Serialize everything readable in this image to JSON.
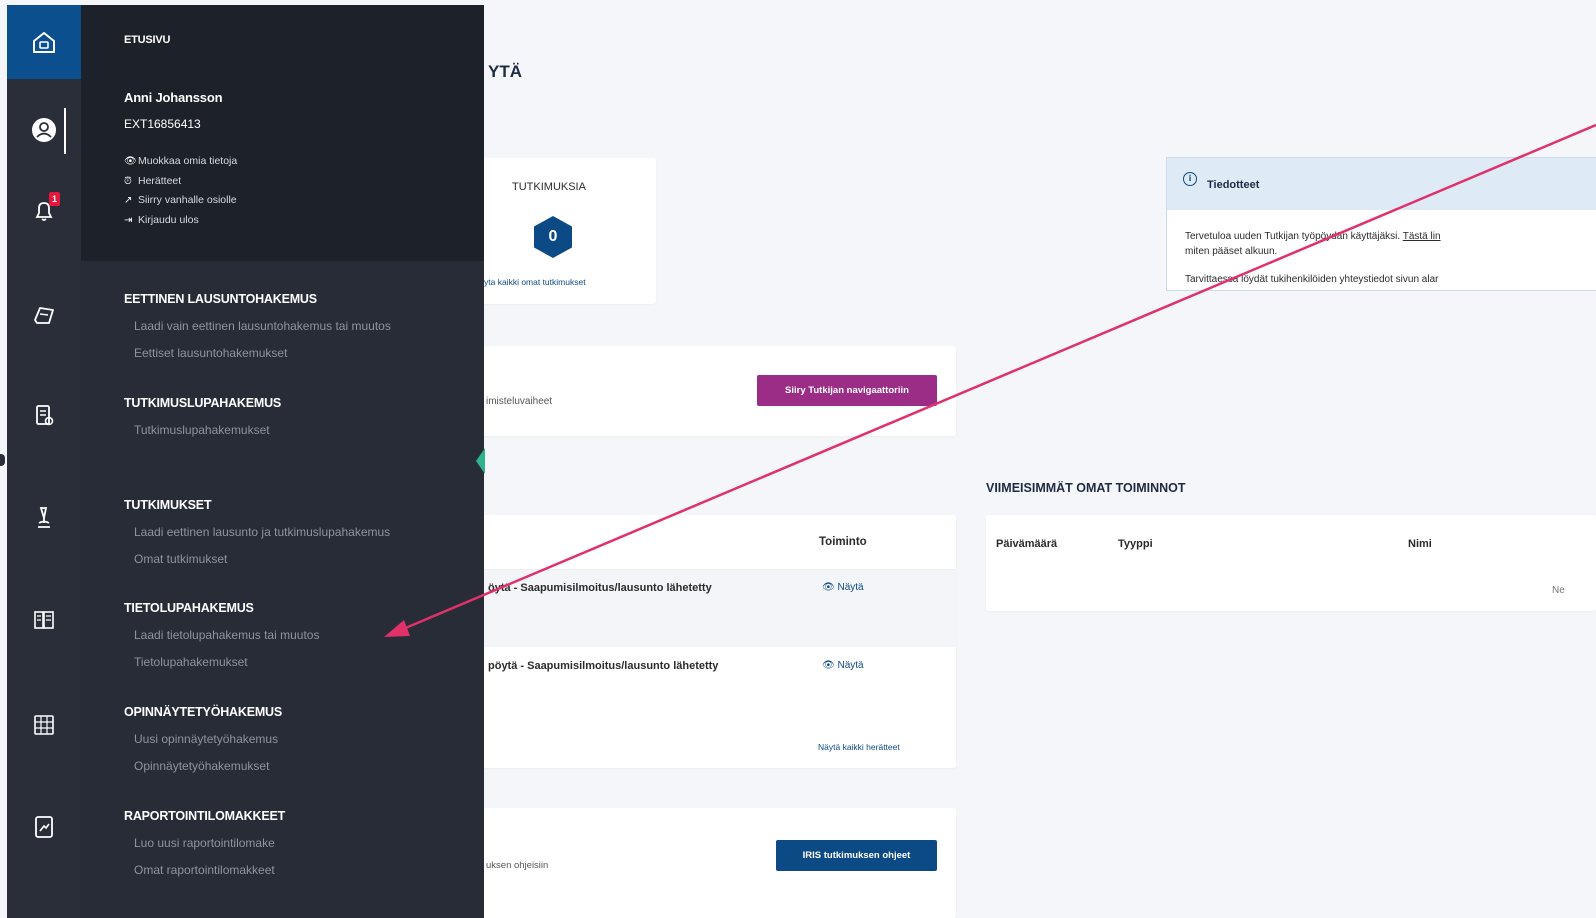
{
  "menu": {
    "home": "ETUSIVU",
    "user_name": "Anni Johansson",
    "user_id": "EXT16856413",
    "user_links": [
      {
        "icon": "eye-icon",
        "label": "Muokkaa omia tietoja"
      },
      {
        "icon": "alarm-icon",
        "label": "Herätteet"
      },
      {
        "icon": "external-link-icon",
        "label": "Siirry vanhalle osiolle"
      },
      {
        "icon": "logout-icon",
        "label": "Kirjaudu ulos"
      }
    ],
    "sections": [
      {
        "title": "EETTINEN LAUSUNTOHAKEMUS",
        "items": [
          "Laadi vain eettinen lausuntohakemus tai muutos",
          "Eettiset lausuntohakemukset"
        ]
      },
      {
        "title": "TUTKIMUSLUPAHAKEMUS",
        "items": [
          "Tutkimuslupahakemukset"
        ]
      },
      {
        "title": "TUTKIMUKSET",
        "items": [
          "Laadi eettinen lausunto ja tutkimuslupahakemus",
          "Omat tutkimukset"
        ]
      },
      {
        "title": "TIETOLUPAHAKEMUS",
        "items": [
          "Laadi tietolupahakemus tai muutos",
          "Tietolupahakemukset"
        ]
      },
      {
        "title": "OPINNÄYTETYÖHAKEMUS",
        "items": [
          "Uusi opinnäytetyöhakemus",
          "Opinnäytetyöhakemukset"
        ]
      },
      {
        "title": "RAPORTOINTILOMAKKEET",
        "items": [
          "Luo uusi raportointilomake",
          "Omat raportointilomakkeet"
        ]
      }
    ]
  },
  "rail": {
    "icons": [
      "home-icon",
      "user-icon",
      "notification-icon",
      "application-icon",
      "scroll-icon",
      "microscope-icon",
      "data-permit-icon",
      "thesis-icon",
      "report-icon"
    ],
    "notification_count": "1"
  },
  "main": {
    "page_title_fragment": "YTÄ",
    "studies_card": {
      "label": "TUTKIMUKSIA",
      "count": "0",
      "link": "yta kaikki omat tutkimukset"
    },
    "navigator_card": {
      "text": "imisteluvaiheet",
      "button": "Siiry Tutkijan navigaattoriin"
    },
    "notifications_table": {
      "header_action": "Toiminto",
      "rows": [
        {
          "text": "öytä - Saapumisilmoitus/lausunto lähetetty",
          "action": "Näytä"
        },
        {
          "text": "pöytä - Saapumisilmoitus/lausunto lähetetty",
          "action": "Näytä"
        }
      ],
      "footer_link": "Näytä kaikki herätteet"
    },
    "guide_card": {
      "text": "uksen ohjeisiin",
      "button": "IRIS tutkimuksen ohjeet"
    },
    "info": {
      "title": "Tiedotteet",
      "line1": "Tervetuloa uuden Tutkijan työpöydän käyttäjäksi. ",
      "line1_link": "Tästä lin",
      "line2": "miten pääset alkuun.",
      "line3": "Tarvittaessa löydät tukihenkilöiden yhteystiedot sivun alar"
    },
    "recent": {
      "title": "VIIMEISIMMÄT OMAT TOIMINNOT",
      "columns": [
        "Päivämäärä",
        "Tyyppi",
        "Nimi"
      ],
      "empty_fragment": "Ne"
    }
  },
  "colors": {
    "rail_bg": "#2a2e38",
    "menu_bg": "#272c36",
    "menu_top_bg": "#1d2129",
    "active_blue": "#0b4f8f",
    "purple_button": "#9b2d86",
    "navy_button": "#0c4a85",
    "arrow": "#e0316a",
    "teal_tab": "#2fb38d"
  }
}
